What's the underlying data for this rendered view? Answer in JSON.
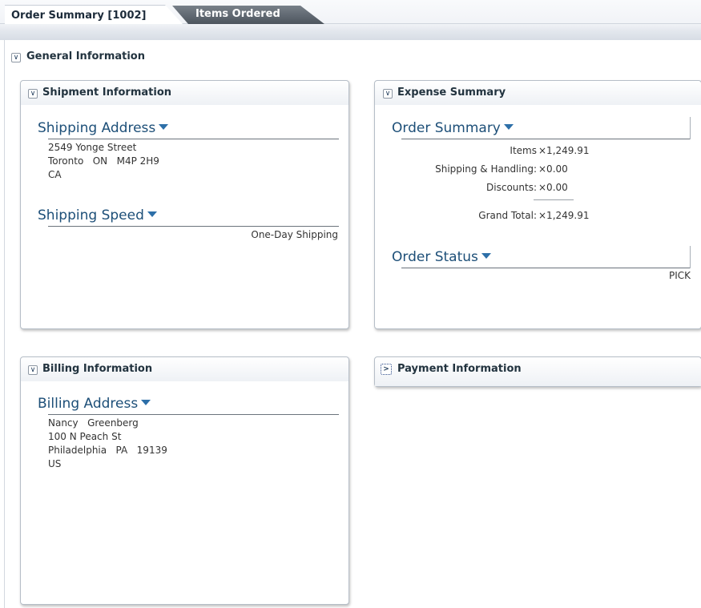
{
  "tabs": [
    {
      "label": "Order Summary [1002]",
      "active": true
    },
    {
      "label": "Items Ordered",
      "active": false
    }
  ],
  "general": {
    "title": "General Information",
    "toggle": "expanded"
  },
  "shipment": {
    "title": "Shipment Information",
    "address_label": "Shipping Address",
    "address_lines": [
      "2549 Yonge Street",
      "Toronto   ON   M4P 2H9",
      "CA"
    ],
    "speed_label": "Shipping Speed",
    "speed_value": "One-Day Shipping"
  },
  "expense": {
    "title": "Expense Summary",
    "summary_label": "Order Summary",
    "rows": [
      {
        "label": "Items",
        "value": "×1,249.91"
      },
      {
        "label": "Shipping & Handling:",
        "value": "×0.00"
      },
      {
        "label": "Discounts:",
        "value": "×0.00"
      }
    ],
    "grand_total_label": "Grand Total:",
    "grand_total_value": "×1,249.91",
    "status_label": "Order Status",
    "status_value": "PICK"
  },
  "billing": {
    "title": "Billing Information",
    "address_label": "Billing Address",
    "address_lines": [
      "Nancy   Greenberg",
      "100 N Peach St",
      "Philadelphia   PA   19139",
      "US"
    ]
  },
  "payment": {
    "title": "Payment Information",
    "toggle": "collapsed"
  },
  "icons": {
    "expanded": "∨",
    "collapsed": ">"
  },
  "colors": {
    "subhead": "#1d4f78",
    "caret": "#2d6fa8",
    "tab_inactive": "#5b636c"
  }
}
